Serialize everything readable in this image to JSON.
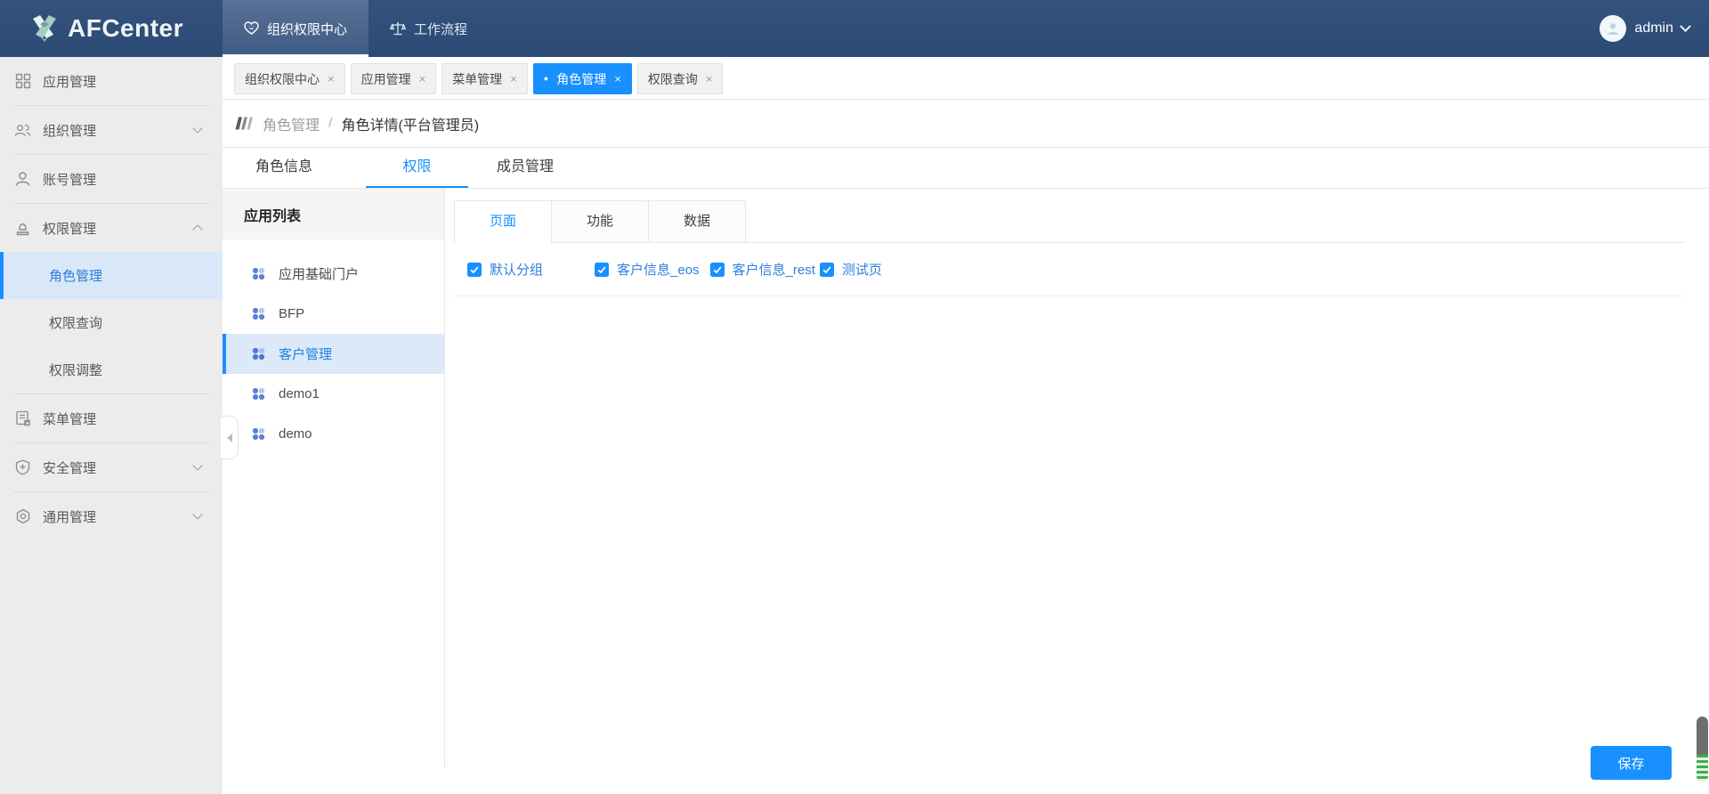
{
  "header": {
    "logo_text": "AFCenter",
    "nav": [
      {
        "label": "组织权限中心",
        "active": true
      },
      {
        "label": "工作流程",
        "active": false
      }
    ],
    "user": {
      "name": "admin"
    }
  },
  "tab_strip": {
    "close_glyph": "×",
    "active_dot": "●",
    "tabs": [
      {
        "label": "组织权限中心",
        "active": false
      },
      {
        "label": "应用管理",
        "active": false
      },
      {
        "label": "菜单管理",
        "active": false
      },
      {
        "label": "角色管理",
        "active": true
      },
      {
        "label": "权限查询",
        "active": false
      }
    ]
  },
  "breadcrumb": {
    "parent": "角色管理",
    "separator": "/",
    "current": "角色详情(平台管理员)"
  },
  "role_tabs": [
    {
      "label": "角色信息",
      "active": false
    },
    {
      "label": "权限",
      "active": true
    },
    {
      "label": "成员管理",
      "active": false
    }
  ],
  "sidebar": {
    "items": [
      {
        "label": "应用管理",
        "icon": "appstore-icon"
      },
      {
        "label": "组织管理",
        "icon": "team-icon",
        "chevron": "down"
      },
      {
        "label": "账号管理",
        "icon": "user-icon"
      },
      {
        "label": "权限管理",
        "icon": "permission-stamp-icon",
        "chevron": "up",
        "expanded": true
      },
      {
        "label": "角色管理",
        "submenu": true,
        "selected": true
      },
      {
        "label": "权限查询",
        "submenu": true
      },
      {
        "label": "权限调整",
        "submenu": true
      },
      {
        "label": "菜单管理",
        "icon": "menu-doc-icon"
      },
      {
        "label": "安全管理",
        "icon": "shield-plus-icon",
        "chevron": "down"
      },
      {
        "label": "通用管理",
        "icon": "circle-dot-icon",
        "chevron": "down"
      }
    ]
  },
  "app_panel": {
    "title": "应用列表",
    "items": [
      {
        "label": "应用基础门户",
        "selected": false
      },
      {
        "label": "BFP",
        "selected": false
      },
      {
        "label": "客户管理",
        "selected": true
      },
      {
        "label": "demo1",
        "selected": false
      },
      {
        "label": "demo",
        "selected": false
      }
    ]
  },
  "perm_tabs": [
    {
      "label": "页面",
      "active": true
    },
    {
      "label": "功能",
      "active": false
    },
    {
      "label": "数据",
      "active": false
    }
  ],
  "checkbox_group": [
    {
      "label": "默认分组",
      "checked": true
    },
    {
      "label": "客户信息_eos",
      "checked": true
    },
    {
      "label": "客户信息_rest",
      "checked": true
    },
    {
      "label": "测试页",
      "checked": true
    }
  ],
  "footer": {
    "save_label": "保存"
  },
  "colors": {
    "accent": "#1890ff",
    "header_bg": "#2e4d78",
    "sidebar_bg": "#ececec",
    "selected_row_bg": "#d9e8f8",
    "scrollbar_thumb": "#6e6e6e",
    "scrollbar_stripe_green": "#3fad4f"
  }
}
